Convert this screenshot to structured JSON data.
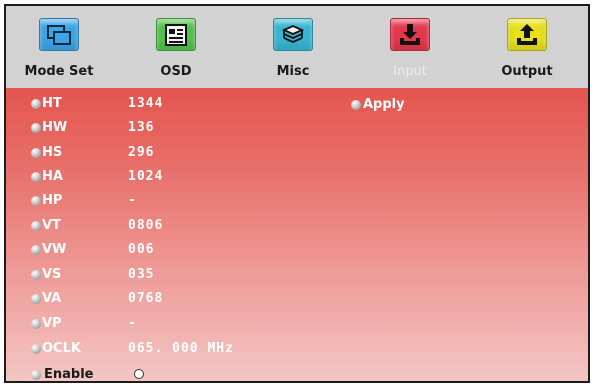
{
  "tabs": [
    {
      "label": "Mode Set",
      "icon": "mode-set-icon",
      "color": "#3ba6e6"
    },
    {
      "label": "OSD",
      "icon": "osd-icon",
      "color": "#52c34a"
    },
    {
      "label": "Misc",
      "icon": "misc-icon",
      "color": "#38b6d4"
    },
    {
      "label": "Input",
      "icon": "input-icon",
      "color": "#e5374d",
      "active": true
    },
    {
      "label": "Output",
      "icon": "output-icon",
      "color": "#e8e01c"
    }
  ],
  "params": [
    {
      "label": "HT",
      "value": "1344"
    },
    {
      "label": "HW",
      "value": "136"
    },
    {
      "label": "HS",
      "value": "296"
    },
    {
      "label": "HA",
      "value": "1024"
    },
    {
      "label": "HP",
      "value": "-"
    },
    {
      "label": "VT",
      "value": "0806"
    },
    {
      "label": "VW",
      "value": "006"
    },
    {
      "label": "VS",
      "value": "035"
    },
    {
      "label": "VA",
      "value": "0768"
    },
    {
      "label": "VP",
      "value": "-"
    },
    {
      "label": "OCLK",
      "value": "065. 000 MHz"
    }
  ],
  "apply": {
    "label": "Apply"
  },
  "enable": {
    "label": "Enable",
    "checked": false
  }
}
